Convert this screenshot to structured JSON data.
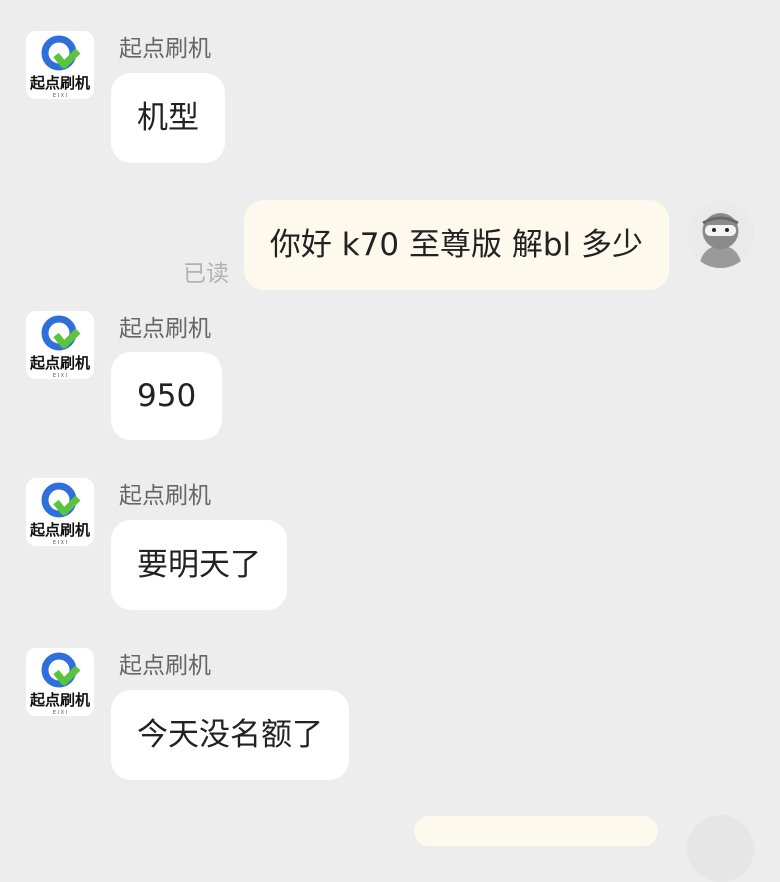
{
  "contact": {
    "name": "起点刷机",
    "logo_text": "起点刷机",
    "logo_subtext": "E I X I"
  },
  "messages": [
    {
      "text": "机型"
    },
    {
      "text": "你好 k70 至尊版 解bl 多少",
      "status": "已读"
    },
    {
      "text": "950"
    },
    {
      "text": "要明天了"
    },
    {
      "text": "今天没名额了"
    }
  ],
  "icons": {
    "contact_avatar": "brand-logo-icon",
    "user_avatar": "ninja-avatar-icon"
  },
  "colors": {
    "background": "#ededed",
    "incoming_bubble": "#ffffff",
    "outgoing_bubble": "#fdf9ed",
    "logo_blue": "#2f6fdc",
    "logo_green": "#5ac43a"
  }
}
